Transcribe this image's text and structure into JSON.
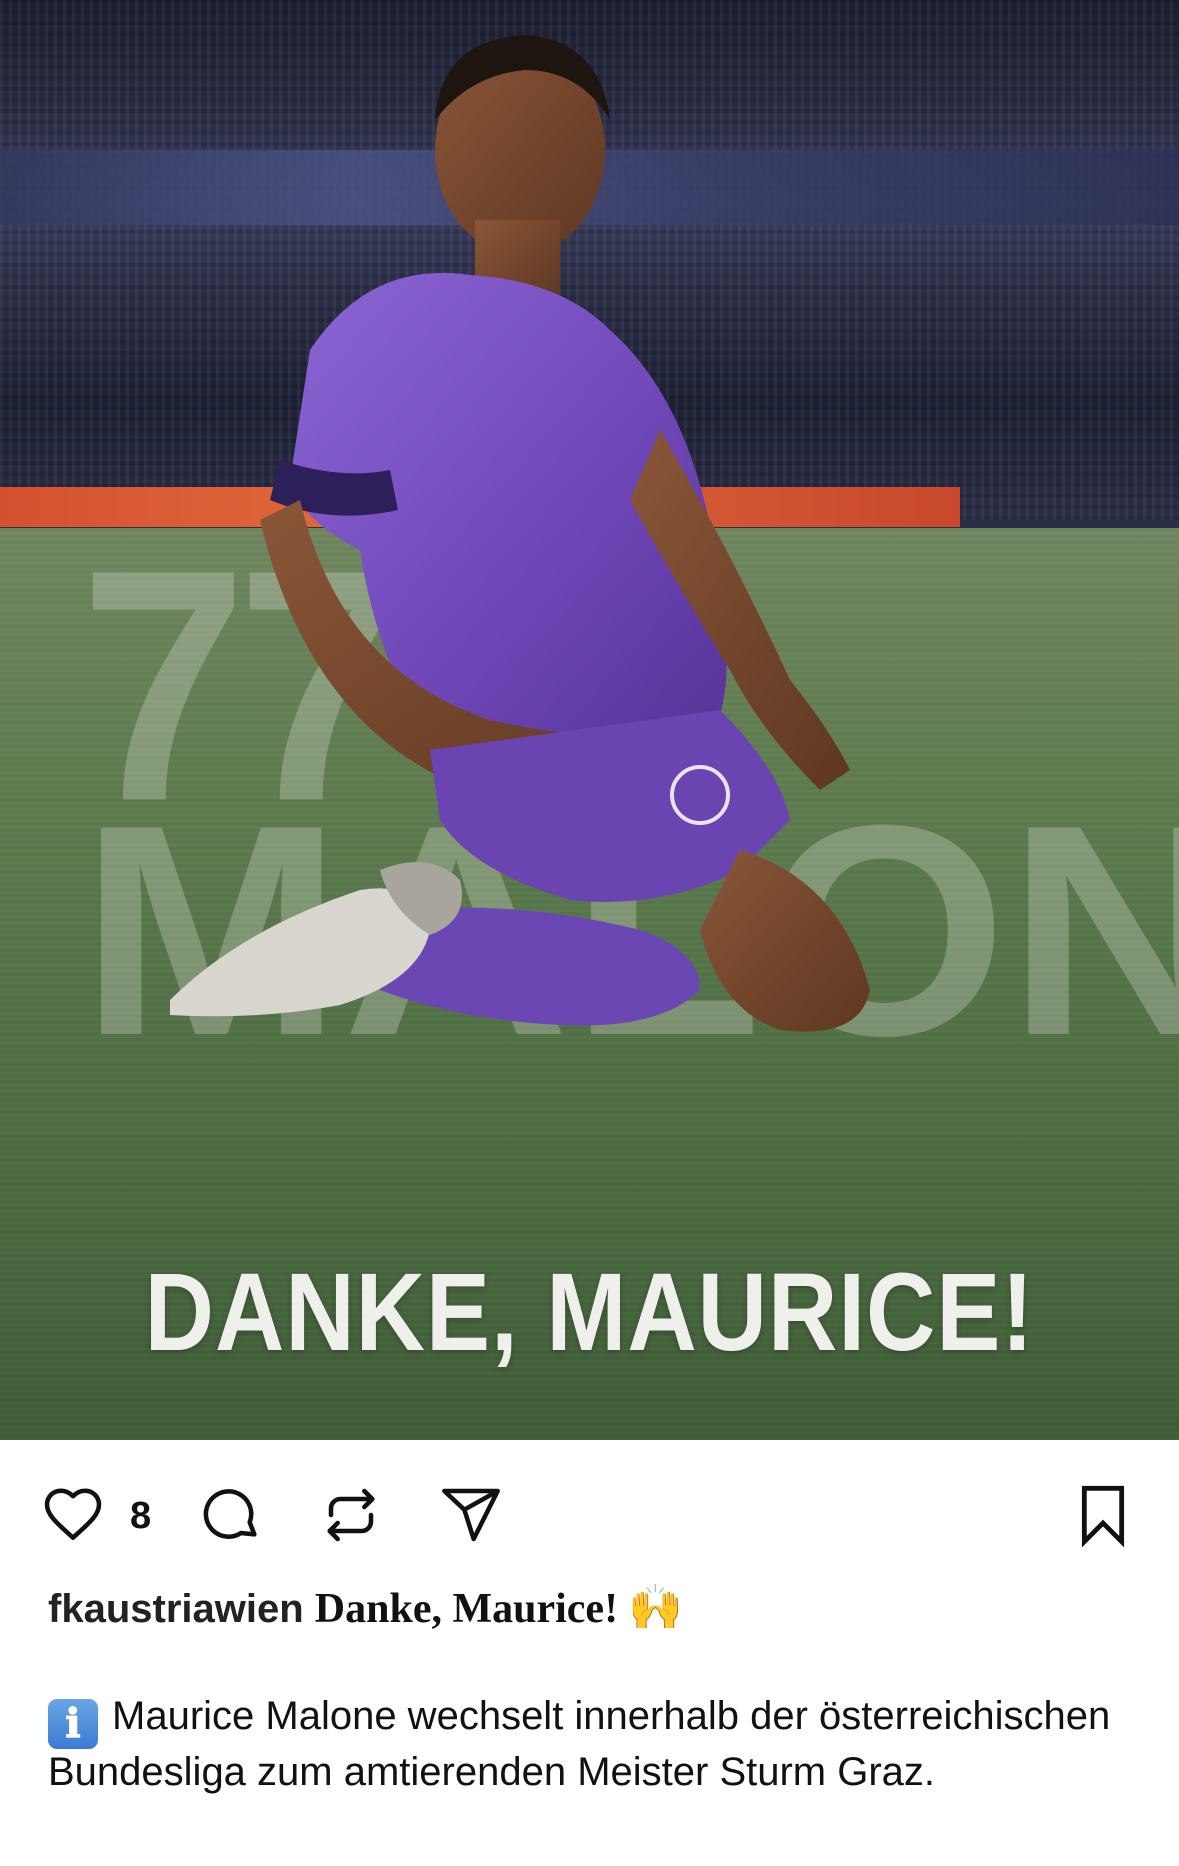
{
  "post": {
    "image": {
      "background_number": "77",
      "background_name": "MALONE",
      "headline": "DANKE, MAURICE!"
    },
    "actions": {
      "like_icon": "heart-icon",
      "like_count": "8",
      "comment_icon": "comment-icon",
      "repost_icon": "repost-icon",
      "share_icon": "send-icon",
      "save_icon": "bookmark-icon"
    },
    "caption": {
      "username": "fkaustriawien",
      "title": "Danke, Maurice!",
      "emoji": "🙌",
      "info_icon": "ℹ",
      "body": "Maurice Malone wechselt innerhalb der österreichischen Bundesliga zum amtierenden Meister Sturm Graz."
    }
  },
  "colors": {
    "jersey": "#7b54c4",
    "pitch": "#4f6b3f",
    "text": "#111111"
  }
}
